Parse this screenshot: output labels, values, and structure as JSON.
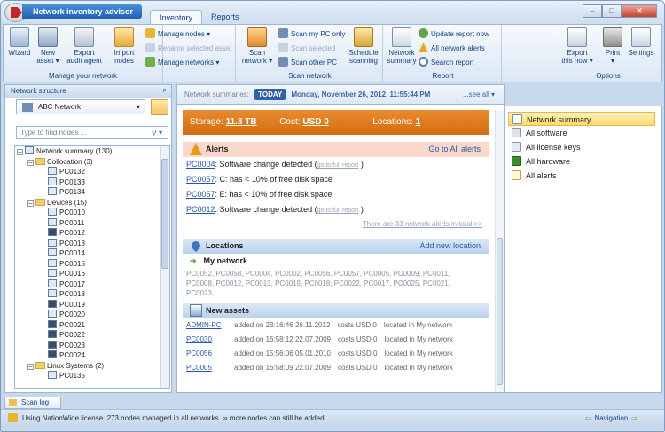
{
  "app": {
    "title": "Network inventory advisor",
    "tabs": [
      "Inventory",
      "Reports"
    ]
  },
  "window": {
    "min": "–",
    "max": "□",
    "close": "✕"
  },
  "ribbon": {
    "manage": {
      "label": "Manage your network",
      "wizard": "Wizard",
      "new_asset": "New\nasset ▾",
      "export_agent": "Export\naudit agent",
      "import_nodes": "Import\nnodes",
      "manage_nodes": "Manage nodes ▾",
      "rename": "Rename selected asset",
      "manage_networks": "Manage networks ▾"
    },
    "scan": {
      "label": "Scan network",
      "scan_network": "Scan\nnetwork ▾",
      "scan_my_pc": "Scan my PC only",
      "scan_selected": "Scan selected",
      "scan_other": "Scan other PC",
      "schedule": "Schedule\nscanning"
    },
    "report": {
      "label": "Report",
      "network_summary": "Network\nsummary",
      "update_report": "Update report now",
      "all_alerts": "All network alerts",
      "search_report": "Search report"
    },
    "options": {
      "label": "Options",
      "export_now": "Export\nthis now ▾",
      "print": "Print\n▾",
      "settings": "Settings"
    }
  },
  "left": {
    "header": "Network structure",
    "pin": "ᵖ",
    "network": "ABC Network",
    "find_placeholder": "Type to find nodes ...",
    "tree": [
      {
        "label": "Network summary (130)",
        "lvl": 0,
        "kind": "root",
        "pm": "–"
      },
      {
        "label": "Collocation (3)",
        "lvl": 1,
        "kind": "folder",
        "pm": "–"
      },
      {
        "label": "PC0132",
        "lvl": 2,
        "kind": "pc"
      },
      {
        "label": "PC0133",
        "lvl": 2,
        "kind": "pc"
      },
      {
        "label": "PC0134",
        "lvl": 2,
        "kind": "pc"
      },
      {
        "label": "Devices (15)",
        "lvl": 1,
        "kind": "folder",
        "pm": "–"
      },
      {
        "label": "PC0010",
        "lvl": 2,
        "kind": "pc"
      },
      {
        "label": "PC0011",
        "lvl": 2,
        "kind": "pc"
      },
      {
        "label": "PC0012",
        "lvl": 2,
        "kind": "pcdk"
      },
      {
        "label": "PC0013",
        "lvl": 2,
        "kind": "pc"
      },
      {
        "label": "PC0014",
        "lvl": 2,
        "kind": "pc"
      },
      {
        "label": "PC0015",
        "lvl": 2,
        "kind": "pc"
      },
      {
        "label": "PC0016",
        "lvl": 2,
        "kind": "pc"
      },
      {
        "label": "PC0017",
        "lvl": 2,
        "kind": "pc"
      },
      {
        "label": "PC0018",
        "lvl": 2,
        "kind": "pc"
      },
      {
        "label": "PC0019",
        "lvl": 2,
        "kind": "pcdk"
      },
      {
        "label": "PC0020",
        "lvl": 2,
        "kind": "pc"
      },
      {
        "label": "PC0021",
        "lvl": 2,
        "kind": "pcdk"
      },
      {
        "label": "PC0022",
        "lvl": 2,
        "kind": "pcdk"
      },
      {
        "label": "PC0023",
        "lvl": 2,
        "kind": "pcdk"
      },
      {
        "label": "PC0024",
        "lvl": 2,
        "kind": "pcdk"
      },
      {
        "label": "Linux Systems (2)",
        "lvl": 1,
        "kind": "folder",
        "pm": "–"
      },
      {
        "label": "PC0135",
        "lvl": 2,
        "kind": "pc"
      }
    ]
  },
  "summary": {
    "label": "Network summaries:",
    "today": "TODAY",
    "date": "Monday, November 26, 2012, 11:55:44 PM",
    "see_all": "...see all ▾"
  },
  "storage": {
    "storage_label": "Storage:",
    "storage_value": "11.8 TB",
    "cost_label": "Cost:",
    "cost_value": "USD 0",
    "locations_label": "Locations:",
    "locations_value": "1"
  },
  "alerts": {
    "title": "Alerts",
    "link": "Go to All alerts",
    "full": "go to full report",
    "items": [
      {
        "pc": "PC0004",
        "text": ": Software change detected (",
        "full": true
      },
      {
        "pc": "PC0057",
        "text": ": C: has < 10% of free disk space",
        "full": false
      },
      {
        "pc": "PC0057",
        "text": ": E: has < 10% of free disk space",
        "full": false
      },
      {
        "pc": "PC0012",
        "text": ": Software change detected (",
        "full": true
      }
    ],
    "more": "There are 33 network alerts in total >>"
  },
  "locations": {
    "title": "Locations",
    "link": "Add new location",
    "name": "My network",
    "nodes": [
      "PC0052, PC0058, PC0004, PC0002, PC0056, PC0057, PC0005, PC0009, PC0011,",
      "PC0008, PC0012, PC0013, PC0019, PC0018, PC0022, PC0017, PC0025, PC0021,",
      "PC0023, ..."
    ]
  },
  "assets": {
    "title": "New assets",
    "rows": [
      {
        "name": "ADMIN-PC",
        "added": "added on 23:16:46 26.11.2012",
        "cost": "costs USD 0",
        "loc": "located in My network"
      },
      {
        "name": "PC0030",
        "added": "added on 16:58:12 22.07.2009",
        "cost": "costs USD 0",
        "loc": "located in My network"
      },
      {
        "name": "PC0056",
        "added": "added on 15:56:06 05.01.2010",
        "cost": "costs USD 0",
        "loc": "located in My network"
      },
      {
        "name": "PC0005",
        "added": "added on 16:58:09 22.07.2009",
        "cost": "costs USD 0",
        "loc": "located in My network"
      }
    ]
  },
  "right": {
    "items": [
      "Network summary",
      "All software",
      "All license keys",
      "All hardware",
      "All alerts"
    ]
  },
  "scanlog": "Scan log",
  "status": {
    "text": "Using NationWide license. 273 nodes managed in all networks. ∞ more nodes can still be added.",
    "nav": "Navigation"
  }
}
